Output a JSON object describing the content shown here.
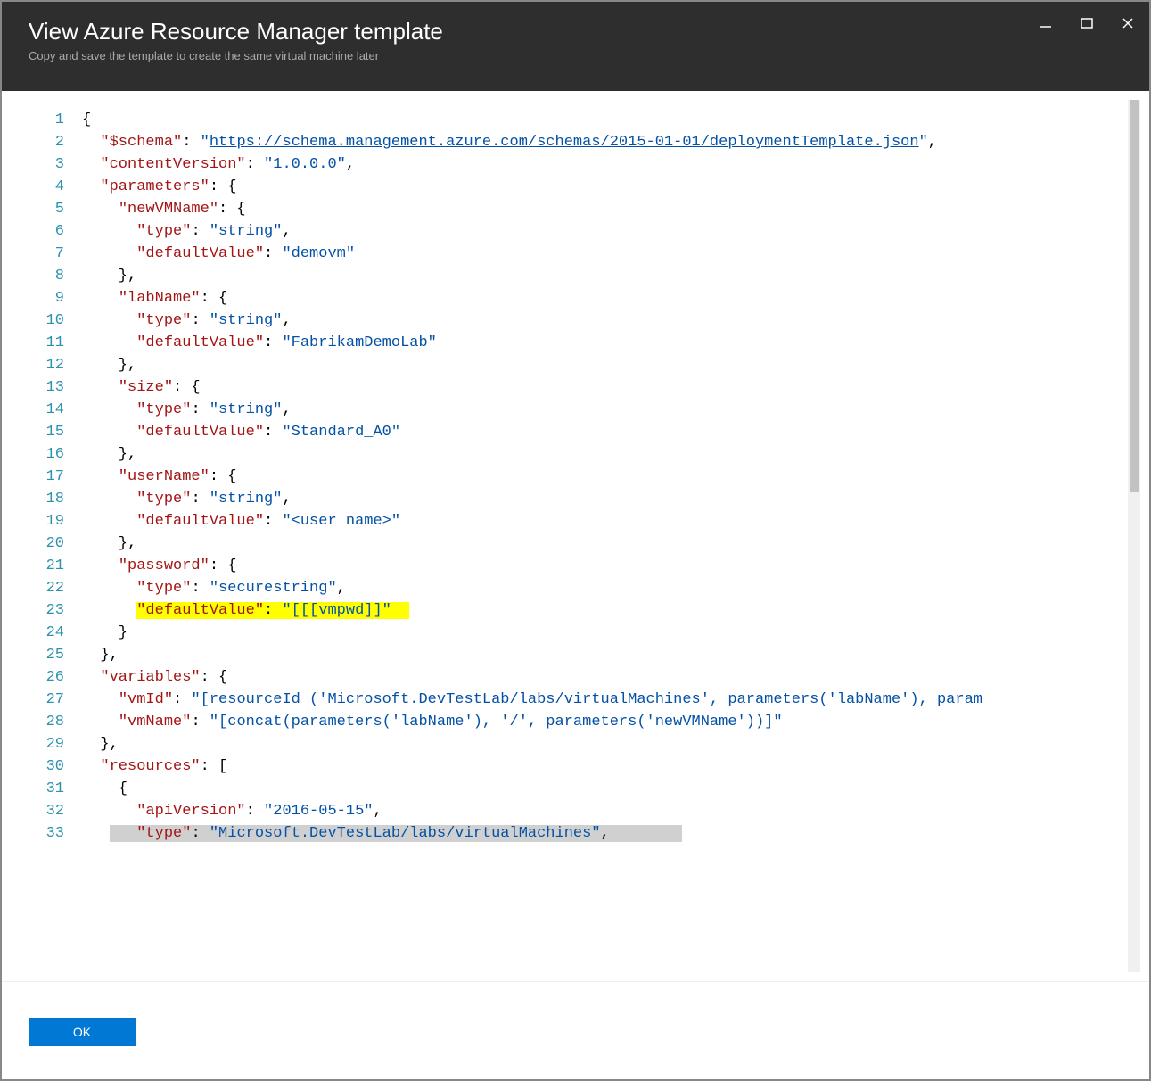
{
  "header": {
    "title": "View Azure Resource Manager template",
    "subtitle": "Copy and save the template to create the same virtual machine later"
  },
  "footer": {
    "ok_label": "OK"
  },
  "code": {
    "lines": [
      {
        "n": 1,
        "tokens": [
          [
            "p",
            "{"
          ]
        ]
      },
      {
        "n": 2,
        "tokens": [
          [
            "p",
            "  "
          ],
          [
            "k",
            "\"$schema\""
          ],
          [
            "p",
            ": "
          ],
          [
            "s",
            "\""
          ],
          [
            "lnk",
            "https://schema.management.azure.com/schemas/2015-01-01/deploymentTemplate.json"
          ],
          [
            "s",
            "\""
          ],
          [
            "p",
            ","
          ]
        ]
      },
      {
        "n": 3,
        "tokens": [
          [
            "p",
            "  "
          ],
          [
            "k",
            "\"contentVersion\""
          ],
          [
            "p",
            ": "
          ],
          [
            "s",
            "\"1.0.0.0\""
          ],
          [
            "p",
            ","
          ]
        ]
      },
      {
        "n": 4,
        "tokens": [
          [
            "p",
            "  "
          ],
          [
            "k",
            "\"parameters\""
          ],
          [
            "p",
            ": {"
          ]
        ]
      },
      {
        "n": 5,
        "tokens": [
          [
            "p",
            "    "
          ],
          [
            "k",
            "\"newVMName\""
          ],
          [
            "p",
            ": {"
          ]
        ]
      },
      {
        "n": 6,
        "tokens": [
          [
            "p",
            "      "
          ],
          [
            "k",
            "\"type\""
          ],
          [
            "p",
            ": "
          ],
          [
            "s",
            "\"string\""
          ],
          [
            "p",
            ","
          ]
        ]
      },
      {
        "n": 7,
        "tokens": [
          [
            "p",
            "      "
          ],
          [
            "k",
            "\"defaultValue\""
          ],
          [
            "p",
            ": "
          ],
          [
            "s",
            "\"demovm\""
          ]
        ]
      },
      {
        "n": 8,
        "tokens": [
          [
            "p",
            "    },"
          ]
        ]
      },
      {
        "n": 9,
        "tokens": [
          [
            "p",
            "    "
          ],
          [
            "k",
            "\"labName\""
          ],
          [
            "p",
            ": {"
          ]
        ]
      },
      {
        "n": 10,
        "tokens": [
          [
            "p",
            "      "
          ],
          [
            "k",
            "\"type\""
          ],
          [
            "p",
            ": "
          ],
          [
            "s",
            "\"string\""
          ],
          [
            "p",
            ","
          ]
        ]
      },
      {
        "n": 11,
        "tokens": [
          [
            "p",
            "      "
          ],
          [
            "k",
            "\"defaultValue\""
          ],
          [
            "p",
            ": "
          ],
          [
            "s",
            "\"FabrikamDemoLab\""
          ]
        ]
      },
      {
        "n": 12,
        "tokens": [
          [
            "p",
            "    },"
          ]
        ]
      },
      {
        "n": 13,
        "tokens": [
          [
            "p",
            "    "
          ],
          [
            "k",
            "\"size\""
          ],
          [
            "p",
            ": {"
          ]
        ]
      },
      {
        "n": 14,
        "tokens": [
          [
            "p",
            "      "
          ],
          [
            "k",
            "\"type\""
          ],
          [
            "p",
            ": "
          ],
          [
            "s",
            "\"string\""
          ],
          [
            "p",
            ","
          ]
        ]
      },
      {
        "n": 15,
        "tokens": [
          [
            "p",
            "      "
          ],
          [
            "k",
            "\"defaultValue\""
          ],
          [
            "p",
            ": "
          ],
          [
            "s",
            "\"Standard_A0\""
          ]
        ]
      },
      {
        "n": 16,
        "tokens": [
          [
            "p",
            "    },"
          ]
        ]
      },
      {
        "n": 17,
        "tokens": [
          [
            "p",
            "    "
          ],
          [
            "k",
            "\"userName\""
          ],
          [
            "p",
            ": {"
          ]
        ]
      },
      {
        "n": 18,
        "tokens": [
          [
            "p",
            "      "
          ],
          [
            "k",
            "\"type\""
          ],
          [
            "p",
            ": "
          ],
          [
            "s",
            "\"string\""
          ],
          [
            "p",
            ","
          ]
        ]
      },
      {
        "n": 19,
        "tokens": [
          [
            "p",
            "      "
          ],
          [
            "k",
            "\"defaultValue\""
          ],
          [
            "p",
            ": "
          ],
          [
            "s",
            "\"<user name>\""
          ]
        ]
      },
      {
        "n": 20,
        "tokens": [
          [
            "p",
            "    },"
          ]
        ]
      },
      {
        "n": 21,
        "tokens": [
          [
            "p",
            "    "
          ],
          [
            "k",
            "\"password\""
          ],
          [
            "p",
            ": {"
          ]
        ]
      },
      {
        "n": 22,
        "tokens": [
          [
            "p",
            "      "
          ],
          [
            "k",
            "\"type\""
          ],
          [
            "p",
            ": "
          ],
          [
            "s",
            "\"securestring\""
          ],
          [
            "p",
            ","
          ]
        ]
      },
      {
        "n": 23,
        "highlight": true,
        "tokens": [
          [
            "p",
            "      "
          ],
          [
            "k",
            "\"defaultValue\""
          ],
          [
            "p",
            ": "
          ],
          [
            "s",
            "\"[[[vmpwd]]\""
          ]
        ]
      },
      {
        "n": 24,
        "tokens": [
          [
            "p",
            "    }"
          ]
        ]
      },
      {
        "n": 25,
        "tokens": [
          [
            "p",
            "  },"
          ]
        ]
      },
      {
        "n": 26,
        "tokens": [
          [
            "p",
            "  "
          ],
          [
            "k",
            "\"variables\""
          ],
          [
            "p",
            ": {"
          ]
        ]
      },
      {
        "n": 27,
        "tokens": [
          [
            "p",
            "    "
          ],
          [
            "k",
            "\"vmId\""
          ],
          [
            "p",
            ": "
          ],
          [
            "s",
            "\"[resourceId ('Microsoft.DevTestLab/labs/virtualMachines', parameters('labName'), param"
          ]
        ]
      },
      {
        "n": 28,
        "tokens": [
          [
            "p",
            "    "
          ],
          [
            "k",
            "\"vmName\""
          ],
          [
            "p",
            ": "
          ],
          [
            "s",
            "\"[concat(parameters('labName'), '/', parameters('newVMName'))]\""
          ]
        ]
      },
      {
        "n": 29,
        "tokens": [
          [
            "p",
            "  },"
          ]
        ]
      },
      {
        "n": 30,
        "tokens": [
          [
            "p",
            "  "
          ],
          [
            "k",
            "\"resources\""
          ],
          [
            "p",
            ": ["
          ]
        ]
      },
      {
        "n": 31,
        "tokens": [
          [
            "p",
            "    {"
          ]
        ]
      },
      {
        "n": 32,
        "tokens": [
          [
            "p",
            "      "
          ],
          [
            "k",
            "\"apiVersion\""
          ],
          [
            "p",
            ": "
          ],
          [
            "s",
            "\"2016-05-15\""
          ],
          [
            "p",
            ","
          ]
        ]
      },
      {
        "n": 33,
        "selected": true,
        "tokens": [
          [
            "p",
            "      "
          ],
          [
            "k",
            "\"type\""
          ],
          [
            "p",
            ": "
          ],
          [
            "s",
            "\"Microsoft.DevTestLab/labs/virtualMachines\""
          ],
          [
            "p",
            ","
          ]
        ]
      }
    ]
  }
}
